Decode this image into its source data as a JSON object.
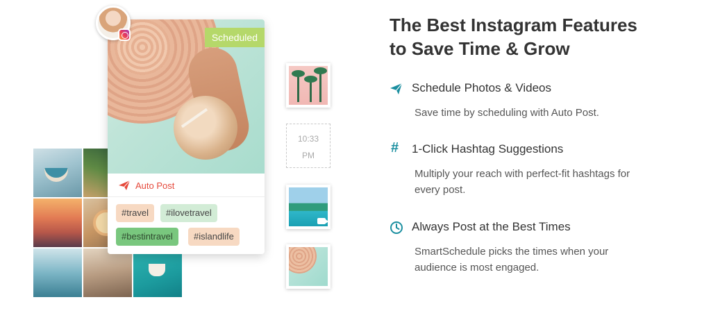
{
  "mockup": {
    "scheduled_label": "Scheduled",
    "autopost_label": "Auto Post",
    "hashtags": [
      "#travel",
      "#ilovetravel",
      "#bestintravel",
      "#islandlife"
    ],
    "time_slot": {
      "time": "10:33",
      "period": "PM"
    }
  },
  "headline": {
    "line1": "The Best Instagram Features",
    "line2": "to Save Time & Grow"
  },
  "features": [
    {
      "icon": "paper-plane-icon",
      "title": "Schedule Photos & Videos",
      "description": "Save time by scheduling with Auto Post."
    },
    {
      "icon": "hashtag-icon",
      "title": "1-Click Hashtag Suggestions",
      "description": "Multiply your reach with perfect-fit hashtags for every post."
    },
    {
      "icon": "clock-icon",
      "title": "Always Post at the Best Times",
      "description": "SmartSchedule picks the times when your audience is most engaged."
    }
  ],
  "colors": {
    "accent_teal": "#1b8fa0",
    "auto_post_red": "#e5483a",
    "scheduled_green": "#b5d86a",
    "hashtag_peach": "#f7d9c2",
    "hashtag_mint": "#d2ecd6",
    "hashtag_green": "#79c77e"
  }
}
